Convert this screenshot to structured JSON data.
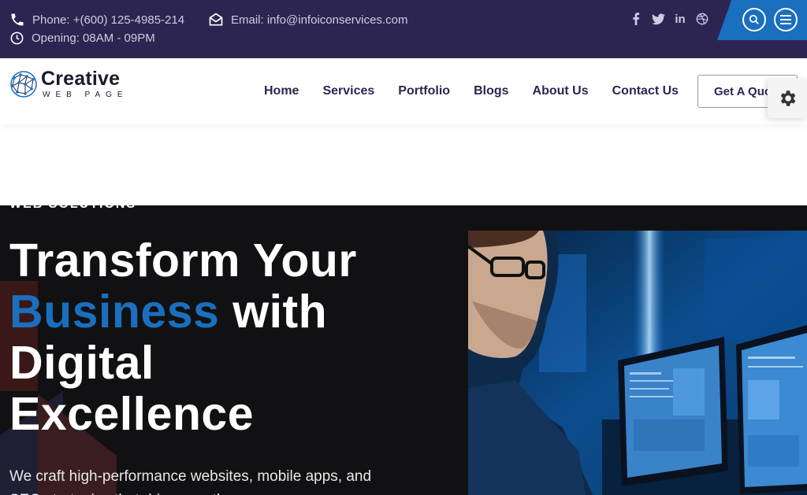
{
  "topbar": {
    "phone": "Phone: +(600) 125-4985-214",
    "email": "Email: info@infoiconservices.com",
    "opening": "Opening: 08AM - 09PM",
    "socials": [
      "facebook-icon",
      "twitter-icon",
      "linkedin-icon",
      "dribbble-icon"
    ],
    "accent_color": "#1a6fbe",
    "background_color": "#2d2551"
  },
  "header": {
    "logo_main": "Creative",
    "logo_sub": "WEB PAGE",
    "nav": [
      "Home",
      "Services",
      "Portfolio",
      "Blogs",
      "About Us",
      "Contact Us"
    ],
    "quote_button": "Get A Quote"
  },
  "hero": {
    "eyebrow": "WEB SOLUTIONS",
    "headline_line1": "Transform Your",
    "headline_highlight": "Business",
    "headline_with": "with",
    "headline_line3": "Digital",
    "headline_line4": "Excellence",
    "description": "We craft high-performance websites, mobile apps, and SEO strategies that drive growth.",
    "highlight_color": "#1a6fbe"
  }
}
